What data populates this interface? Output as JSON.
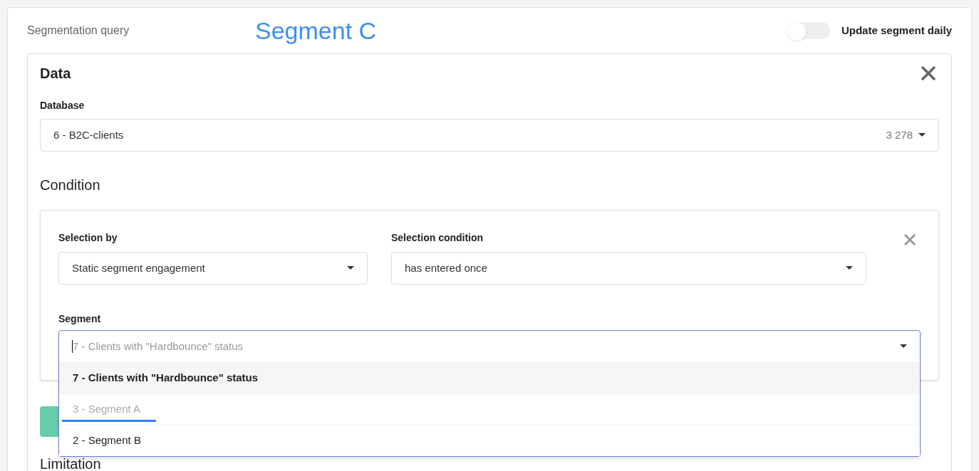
{
  "header": {
    "label": "Segmentation query",
    "segment_name": "Segment C",
    "toggle": {
      "label": "Update segment daily",
      "on": false
    }
  },
  "data": {
    "title": "Data",
    "database": {
      "label": "Database",
      "value": "6 - B2C-clients",
      "count": "3 278"
    }
  },
  "condition": {
    "title": "Condition",
    "selection_by": {
      "label": "Selection by",
      "value": "Static segment engagement"
    },
    "selection_condition": {
      "label": "Selection condition",
      "value": "has entered once"
    },
    "segment": {
      "label": "Segment",
      "placeholder": "7 - Clients with \"Hardbounce\" status",
      "options": [
        {
          "label": "7 - Clients with \"Hardbounce\" status",
          "selected": true,
          "disabled": false
        },
        {
          "label": "3 - Segment A",
          "selected": false,
          "disabled": true
        },
        {
          "label": "2 - Segment B",
          "selected": false,
          "disabled": false
        }
      ]
    }
  },
  "limitation": {
    "title": "Limitation"
  }
}
